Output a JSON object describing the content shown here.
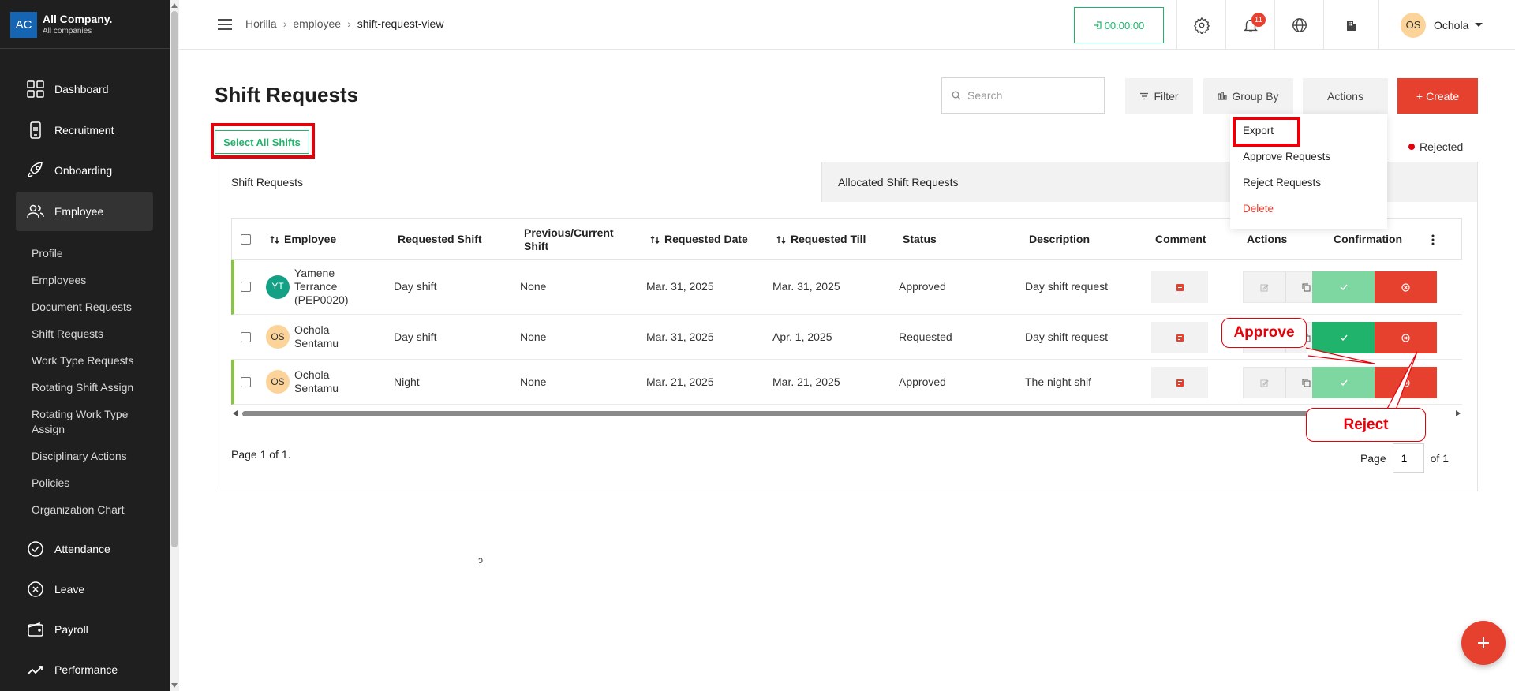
{
  "company": {
    "logo": "AC",
    "name": "All Company.",
    "subtitle": "All companies"
  },
  "sidebar": {
    "main_items": [
      {
        "label": "Dashboard",
        "icon": "dashboard-grid-icon"
      },
      {
        "label": "Recruitment",
        "icon": "phone-icon"
      },
      {
        "label": "Onboarding",
        "icon": "rocket-icon"
      },
      {
        "label": "Employee",
        "icon": "people-icon",
        "active": true
      }
    ],
    "employee_sub_items": [
      "Profile",
      "Employees",
      "Document Requests",
      "Shift Requests",
      "Work Type Requests",
      "Rotating Shift Assign",
      "Rotating Work Type Assign",
      "Disciplinary Actions",
      "Policies",
      "Organization Chart"
    ],
    "lower_items": [
      {
        "label": "Attendance",
        "icon": "check-circle-icon"
      },
      {
        "label": "Leave",
        "icon": "x-circle-icon"
      },
      {
        "label": "Payroll",
        "icon": "wallet-icon"
      },
      {
        "label": "Performance",
        "icon": "trend-icon"
      }
    ]
  },
  "header": {
    "breadcrumb": [
      "Horilla",
      "employee",
      "shift-request-view"
    ],
    "timer": "00:00:00",
    "notification_count": "11",
    "user": {
      "initials": "OS",
      "name": "Ochola"
    }
  },
  "page": {
    "title": "Shift Requests",
    "search_placeholder": "Search",
    "filter_label": "Filter",
    "group_by_label": "Group By",
    "actions_label": "Actions",
    "create_label": "Create",
    "select_all_label": "Select All Shifts",
    "legend_rejected": "Rejected",
    "actions_menu": [
      "Export",
      "Approve Requests",
      "Reject Requests",
      "Delete"
    ]
  },
  "tabs": [
    "Shift Requests",
    "Allocated Shift Requests"
  ],
  "table": {
    "columns": [
      "Employee",
      "Requested Shift",
      "Previous/Current Shift",
      "Requested Date",
      "Requested Till",
      "Status",
      "Description",
      "Comment",
      "Actions",
      "Confirmation"
    ],
    "rows": [
      {
        "initials": "YT",
        "avatar_color": "#14a085",
        "avatar_text_color": "#ffffff",
        "employee": "Yamene Terrance (PEP0020)",
        "requested_shift": "Day shift",
        "previous_shift": "None",
        "requested_date": "Mar. 31, 2025",
        "requested_till": "Mar. 31, 2025",
        "status": "Approved",
        "description": "Day shift request",
        "approved": true
      },
      {
        "initials": "OS",
        "avatar_color": "#fcd49a",
        "avatar_text_color": "#333333",
        "employee": "Ochola Sentamu",
        "requested_shift": "Day shift",
        "previous_shift": "None",
        "requested_date": "Mar. 31, 2025",
        "requested_till": "Apr. 1, 2025",
        "status": "Requested",
        "description": "Day shift request",
        "approved": false
      },
      {
        "initials": "OS",
        "avatar_color": "#fcd49a",
        "avatar_text_color": "#333333",
        "employee": "Ochola Sentamu",
        "requested_shift": "Night",
        "previous_shift": "None",
        "requested_date": "Mar. 21, 2025",
        "requested_till": "Mar. 21, 2025",
        "status": "Approved",
        "description": "The night shif",
        "approved": true
      }
    ]
  },
  "pagination": {
    "info": "Page 1 of 1.",
    "page_label": "Page",
    "page_value": "1",
    "of_label": "of 1"
  },
  "annotations": {
    "approve": "Approve",
    "reject": "Reject"
  },
  "colors": {
    "accent_red": "#e6402f",
    "accent_green": "#1fb36b",
    "approved_bar": "#8bc34a",
    "highlight_red": "#e6000a"
  }
}
